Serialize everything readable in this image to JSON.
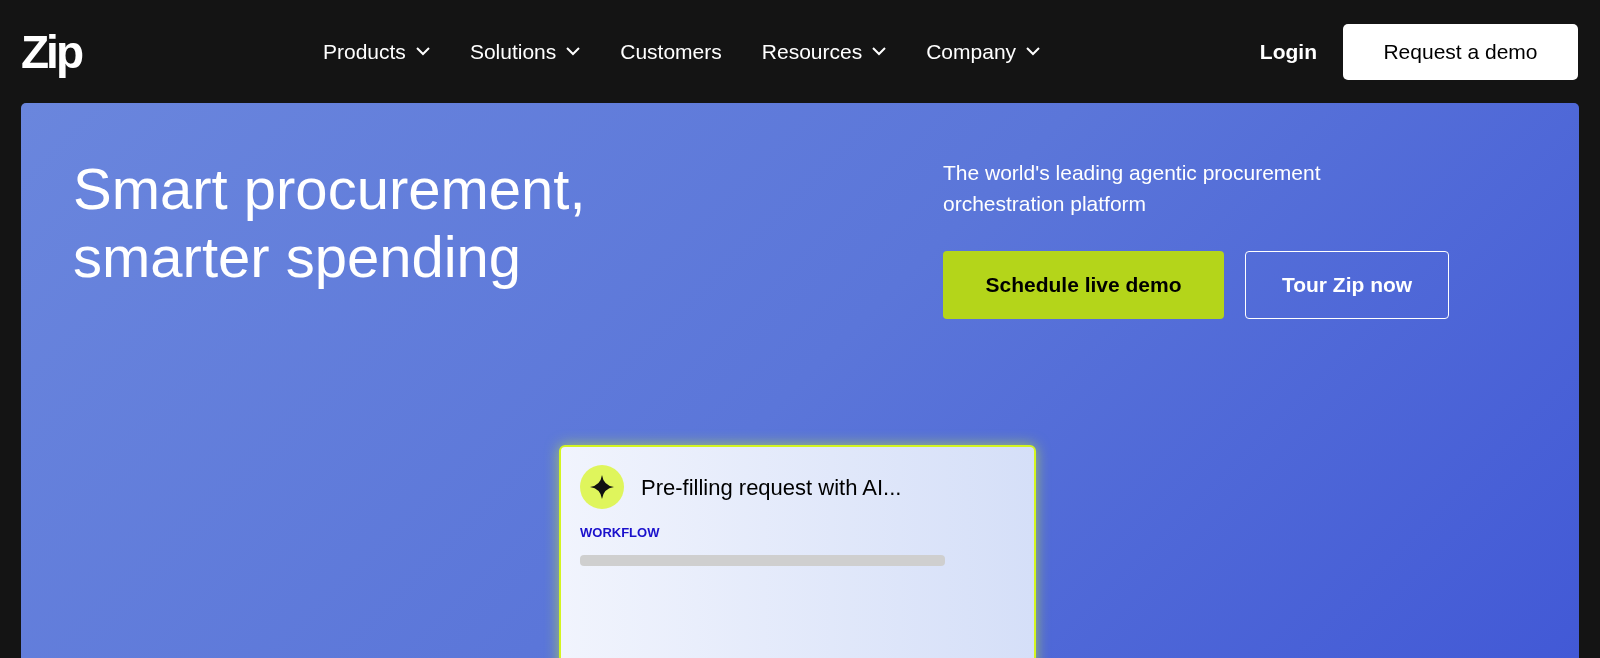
{
  "header": {
    "logo": "Zip",
    "nav": [
      {
        "label": "Products",
        "has_menu": true
      },
      {
        "label": "Solutions",
        "has_menu": true
      },
      {
        "label": "Customers",
        "has_menu": false
      },
      {
        "label": "Resources",
        "has_menu": true
      },
      {
        "label": "Company",
        "has_menu": true
      }
    ],
    "login": "Login",
    "cta": "Request a demo"
  },
  "hero": {
    "headline": [
      "Smart procurement,",
      "smarter spending"
    ],
    "subtitle": "The world's leading agentic procurement orchestration platform",
    "buttons": [
      {
        "label": "Schedule live demo",
        "kind": "primary"
      },
      {
        "label": "Tour Zip now",
        "kind": "outline"
      }
    ],
    "card": {
      "title": "Pre-filling request with AI...",
      "tag": "WORKFLOW"
    }
  }
}
